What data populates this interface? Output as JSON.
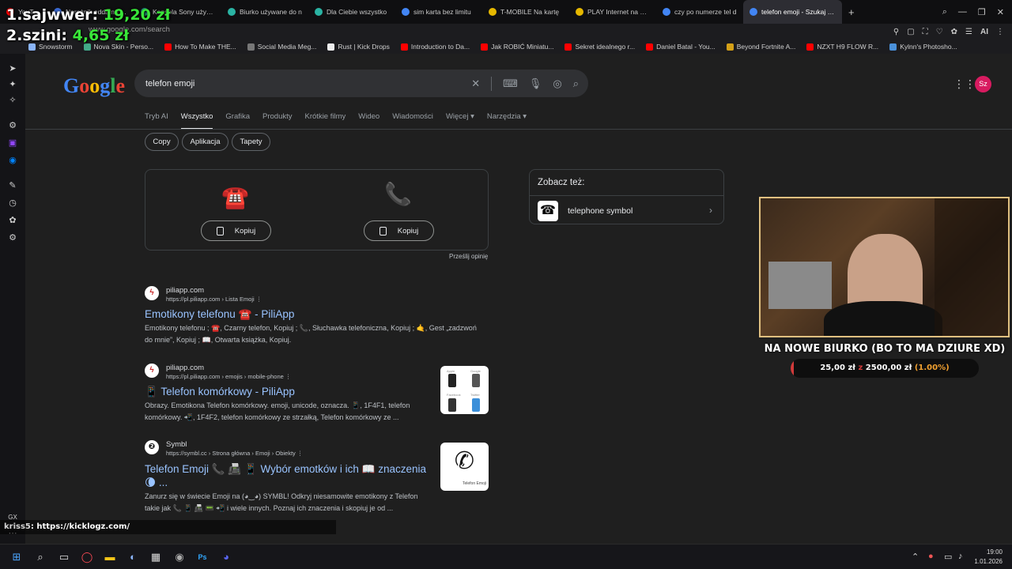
{
  "browser": {
    "tabs": [
      {
        "label": "YouTube",
        "color": "#ff0000"
      },
      {
        "label": "Narożnik oddam za d",
        "color": "#3b6bd6"
      },
      {
        "label": "Konsola Sony używan",
        "color": "#2ab3a3"
      },
      {
        "label": "Biurko używane do n",
        "color": "#2ab3a3"
      },
      {
        "label": "Dla Ciebie wszystko",
        "color": "#2ab3a3"
      },
      {
        "label": "sim karta bez limitu",
        "color": "#4285f4"
      },
      {
        "label": "T-MOBILE Na kartę",
        "color": "#e6b800"
      },
      {
        "label": "PLAY Internet na kart",
        "color": "#e6b800"
      },
      {
        "label": "czy po numerze tel d",
        "color": "#4285f4"
      },
      {
        "label": "telefon emoji - Szukaj w G",
        "color": "#4285f4"
      }
    ],
    "url": "www.google.com/search",
    "bookmarks": [
      "Snowstorm",
      "Nova Skin - Perso...",
      "How To Make THE...",
      "Social Media Meg...",
      "Rust | Kick Drops",
      "Introduction to Da...",
      "Jak ROBIĆ Miniatu...",
      "Sekret idealnego r...",
      "Daniel Batal - You...",
      "Beyond Fortnite A...",
      "NZXT H9 FLOW R...",
      "Kylnn's Photosho..."
    ]
  },
  "overlay": {
    "donors": [
      {
        "rank": "1.",
        "name": "sajwwer:",
        "amount": "19,20 zł"
      },
      {
        "rank": "2.",
        "name": "szini:",
        "amount": "4,65 zł"
      }
    ],
    "goal": {
      "title": "NA NOWE BIURKO (BO TO MA DZIURE XD)",
      "current": "25,00 zł",
      "sep": "z",
      "target": "2500,00 zł",
      "percent_label": "(1.00%)",
      "fraction": 0.01
    },
    "chat": {
      "user": "kriss5",
      "message": ": https://kicklogz.com/"
    }
  },
  "google": {
    "query": "telefon emoji",
    "avatar": "Sz",
    "nav": [
      "Tryb AI",
      "Wszystko",
      "Grafika",
      "Produkty",
      "Krótkie filmy",
      "Wideo",
      "Wiadomości",
      "Więcej",
      "Narzędzia"
    ],
    "chips": [
      "Copy",
      "Aplikacja",
      "Tapety"
    ],
    "emoji_card": {
      "emojis": [
        "☎️",
        "📞"
      ],
      "copy_label": "Kopiuj",
      "feedback": "Prześlij opinię"
    },
    "see_also": {
      "heading": "Zobacz też:",
      "item": "telephone symbol"
    },
    "results": [
      {
        "site": "piliapp.com",
        "url": "https://pl.piliapp.com › Lista Emoji",
        "title": "Emotikony telefonu ☎️ - PiliApp",
        "snippet": "Emotikony telefonu ; ☎️, Czarny telefon, Kopiuj ; 📞, Słuchawka telefoniczna, Kopiuj ; 🤙, Gest „zadzwoń do mnie”, Kopiuj ; 📖, Otwarta książka, Kopiuj."
      },
      {
        "site": "piliapp.com",
        "url": "https://pl.piliapp.com › emojis › mobile-phone",
        "title": "📱 Telefon komórkowy - PiliApp",
        "snippet": "Obrazy. Emotikona Telefon komórkowy. emoji, unicode, oznacza. 📱, 1F4F1, telefon komórkowy. 📲, 1F4F2, telefon komórkowy ze strzałką, Telefon komórkowy ze ..."
      },
      {
        "site": "Symbl",
        "url": "https://symbl.cc › Strona główna › Emoji › Obiekty",
        "title": "Telefon Emoji 📞 📠 📱 Wybór emotków i ich 📖 znaczenia 🌘 ...",
        "snippet": "Zanurz się w świecie Emoji na (◕‿◕) SYMBL! Odkryj niesamowite emotikony z Telefon takie jak 📞 📱 📠 📟 📲 i wiele innych. Poznaj ich znaczenia i skopiuj je od ..."
      }
    ],
    "thumb2_labels": [
      "Apple",
      "Google",
      "Facebook",
      "Twitter"
    ],
    "thumb3_label": "Telefon Emoji"
  },
  "taskbar": {
    "time": "19:00",
    "date": "1.01.2026"
  }
}
